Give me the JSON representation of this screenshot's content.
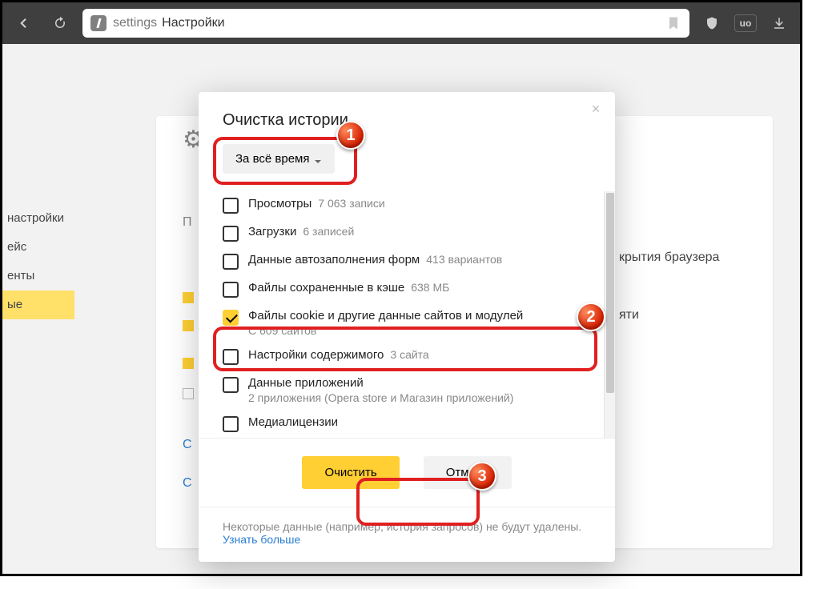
{
  "addressbar": {
    "prefix": "settings",
    "title": "Настройки"
  },
  "bg_sidebar": {
    "items": [
      "настройки",
      "ейс",
      "енты",
      "ые"
    ],
    "selected_index": 3
  },
  "bg_visible_text": [
    "крытия браузера",
    "яти"
  ],
  "modal": {
    "title": "Очистка истории",
    "close_glyph": "×",
    "time_range": "За всё время",
    "items": [
      {
        "label": "Просмотры",
        "detail": "7 063 записи",
        "checked": false
      },
      {
        "label": "Загрузки",
        "detail": "6 записей",
        "checked": false
      },
      {
        "label": "Данные автозаполнения форм",
        "detail": "413 вариантов",
        "checked": false
      },
      {
        "label": "Файлы сохраненные в кэше",
        "detail": "638 МБ",
        "checked": false
      },
      {
        "label": "Файлы cookie и другие данные сайтов и модулей",
        "sub": "С 609 сайтов",
        "checked": true
      },
      {
        "label": "Настройки содержимого",
        "detail": "3 сайта",
        "checked": false
      },
      {
        "label": "Данные приложений",
        "sub": "2 приложения (Opera store и Магазин приложений)",
        "checked": false
      },
      {
        "label": "Медиалицензии",
        "checked": false
      }
    ],
    "primary": "Очистить",
    "secondary": "Отмена",
    "note_text": "Некоторые данные (например, история запросов) не будут удалены.",
    "note_link": "Узнать больше"
  },
  "callouts": {
    "c1": "1",
    "c2": "2",
    "c3": "3"
  }
}
